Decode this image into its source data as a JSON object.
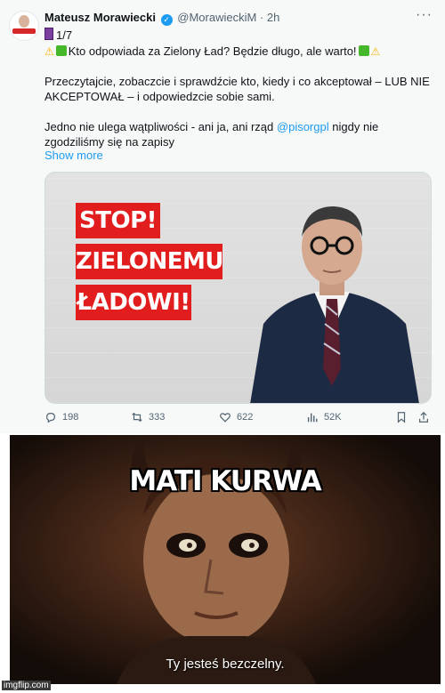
{
  "tweet": {
    "author_name": "Mateusz Morawiecki",
    "handle": "@MorawieckiM",
    "separator": "·",
    "time": "2h",
    "more_icon": "more-horizontal-icon",
    "thread_index": "1/7",
    "line1_text": "Kto odpowiada za Zielony Ład? Będzie długo, ale warto!",
    "para2_line1": "Przeczytajcie, zobaczcie i sprawdźcie kto, kiedy i co akceptował – LUB NIE",
    "para2_line2": "AKCEPTOWAŁ – i odpowiedzcie sobie sami.",
    "para3_line1_before": "Jedno nie ulega wątpliwości - ani ja, ani rząd",
    "mention": "@pisorgpl",
    "para3_line1_after": "nigdy nie",
    "para3_line2": "zgodziliśmy się na zapisy",
    "show_more": "Show more",
    "card": {
      "line1": "STOP!",
      "line2": "ZIELONEMU",
      "line3": "ŁADOWI!"
    },
    "actions": {
      "replies": "198",
      "retweets": "333",
      "likes": "622",
      "views": "52K"
    }
  },
  "meme": {
    "caption": "MATI KURWA",
    "subtitle": "Ty jesteś bezczelny."
  },
  "watermark": "imgflip.com",
  "colors": {
    "accent": "#1d9bf0",
    "stop_red": "#e11d1d"
  }
}
